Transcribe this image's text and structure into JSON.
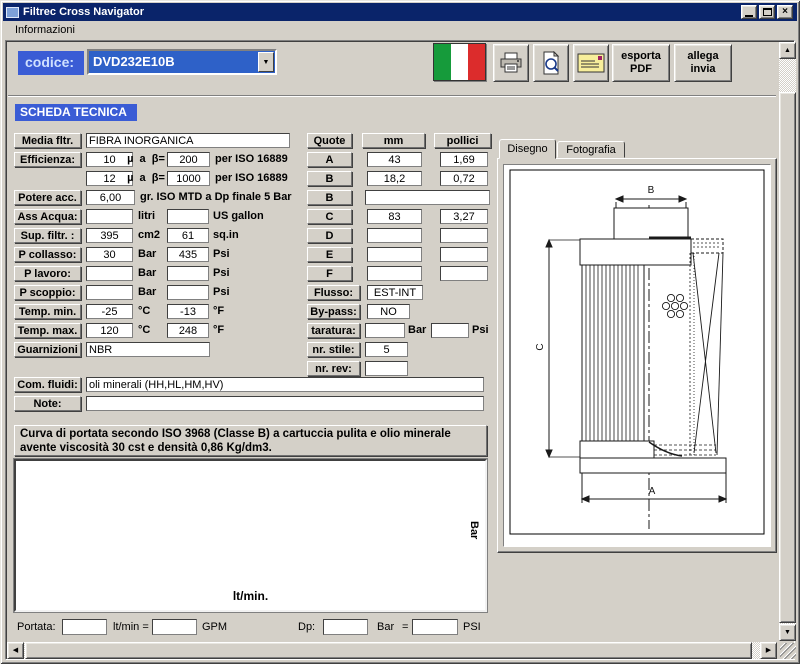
{
  "window": {
    "title": "Filtrec Cross Navigator",
    "close_glyph": "×"
  },
  "menu": {
    "informazioni": "Informazioni"
  },
  "toolbar": {
    "codice_label": "codice:",
    "codice_value": "DVD232E10B",
    "export_pdf": {
      "line1": "esporta",
      "line2": "PDF"
    },
    "attach_send": {
      "line1": "allega",
      "line2": "invia"
    }
  },
  "section": {
    "title": "SCHEDA TECNICA"
  },
  "specs": {
    "media": {
      "label": "Media fltr.",
      "value": "FIBRA INORGANICA"
    },
    "eff": {
      "label": "Efficienza:",
      "r1v1": "10",
      "r1mid": "µ  a  β=",
      "r1v2": "200",
      "r1suf": "per ISO 16889",
      "r2v1": "12",
      "r2mid": "µ  a  β=",
      "r2v2": "1000",
      "r2suf": "per ISO 16889"
    },
    "potere": {
      "label": "Potere acc.",
      "value": "6,00",
      "suffix": "gr. ISO MTD a Dp finale 5 Bar"
    },
    "ass_acqua": {
      "label": "Ass Acqua:",
      "v1": "",
      "u1": "litri",
      "v2": "",
      "u2": "US gallon"
    },
    "sup_filtr": {
      "label": "Sup. filtr. :",
      "v1": "395",
      "u1": "cm2",
      "v2": "61",
      "u2": "sq.in"
    },
    "p_collasso": {
      "label": "P collasso:",
      "v1": "30",
      "u1": "Bar",
      "v2": "435",
      "u2": "Psi"
    },
    "p_lavoro": {
      "label": "P lavoro:",
      "v1": "",
      "u1": "Bar",
      "v2": "",
      "u2": "Psi"
    },
    "p_scoppio": {
      "label": "P scoppio:",
      "v1": "",
      "u1": "Bar",
      "v2": "",
      "u2": "Psi"
    },
    "temp_min": {
      "label": "Temp. min.",
      "v1": "-25",
      "u1": "°C",
      "v2": "-13",
      "u2": "°F"
    },
    "temp_max": {
      "label": "Temp. max.",
      "v1": "120",
      "u1": "°C",
      "v2": "248",
      "u2": "°F"
    },
    "guarnizioni": {
      "label": "Guarnizioni",
      "value": "NBR"
    },
    "com_fluidi": {
      "label": "Com. fluidi:",
      "value": "oli minerali (HH,HL,HM,HV)"
    },
    "note": {
      "label": "Note:",
      "value": ""
    }
  },
  "quote": {
    "header": {
      "quote": "Quote",
      "mm": "mm",
      "pollici": "pollici"
    },
    "rows": [
      {
        "label": "A",
        "mm": "43",
        "pollici": "1,69"
      },
      {
        "label": "B",
        "mm": "18,2",
        "pollici": "0,72"
      },
      {
        "label": "B",
        "wide": ""
      },
      {
        "label": "C",
        "mm": "83",
        "pollici": "3,27"
      },
      {
        "label": "D",
        "mm": "",
        "pollici": ""
      },
      {
        "label": "E",
        "mm": "",
        "pollici": ""
      },
      {
        "label": "F",
        "mm": "",
        "pollici": ""
      }
    ],
    "flusso": {
      "label": "Flusso:",
      "value": "EST-INT"
    },
    "bypass": {
      "label": "By-pass:",
      "value": "NO"
    },
    "taratura": {
      "label": "taratura:",
      "v1": "",
      "u1": "Bar",
      "v2": "",
      "u2": "Psi"
    },
    "nr_stile": {
      "label": "nr. stile:",
      "value": "5"
    },
    "nr_rev": {
      "label": "nr. rev:",
      "value": ""
    }
  },
  "curve": {
    "title": "Curva di portata secondo ISO 3968 (Classe B) a cartuccia pulita e olio minerale avente viscosità 30 cst e densità 0,86 Kg/dm3.",
    "ylabel": "Bar",
    "xlabel": "lt/min."
  },
  "converter": {
    "portata_label": "Portata:",
    "portata_value": "",
    "ltmin_label": "lt/min =",
    "gpm_value": "",
    "gpm_label": "GPM",
    "dp_label": "Dp:",
    "dp_value": "",
    "bar_label": "Bar",
    "eq": "=",
    "psi_value": "",
    "psi_label": "PSI"
  },
  "panel": {
    "tabs": [
      {
        "label": "Disegno"
      },
      {
        "label": "Fotografia"
      }
    ],
    "dim_a": "A",
    "dim_b": "B",
    "dim_c": "C"
  },
  "icons": {
    "dropdown": "▼",
    "up": "▲",
    "down": "▼",
    "left": "◀",
    "right": "▶"
  },
  "colors": {
    "titlebar": "#0a246a",
    "accent_blue": "#3a5cd5",
    "selection_blue": "#2e61c8",
    "window": "#d4d0c8",
    "flag_green": "#169b3b",
    "flag_red": "#dc2c2c"
  }
}
